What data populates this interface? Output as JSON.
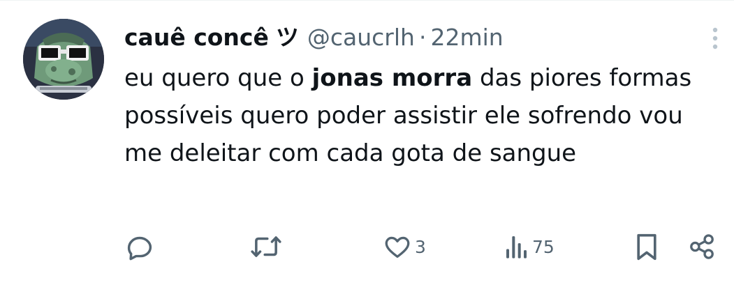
{
  "tweet": {
    "display_name": "cauê concê",
    "name_emoji": "ツ",
    "handle": "@caucrlh",
    "separator": "·",
    "time": "22min",
    "text_before": "eu quero que o ",
    "text_bold": "jonas morra",
    "text_after": " das piores formas possíveis quero poder assistir ele sofrendo vou me deleitar com cada gota de sangue"
  },
  "actions": {
    "reply_icon": "reply-icon",
    "retweet_icon": "retweet-icon",
    "like_icon": "heart-icon",
    "like_count": "3",
    "views_icon": "views-icon",
    "views_count": "75",
    "bookmark_icon": "bookmark-icon",
    "share_icon": "share-icon"
  },
  "colors": {
    "text_primary": "#0f1419",
    "text_secondary": "#536471",
    "more_icon": "#b9c5ce"
  }
}
